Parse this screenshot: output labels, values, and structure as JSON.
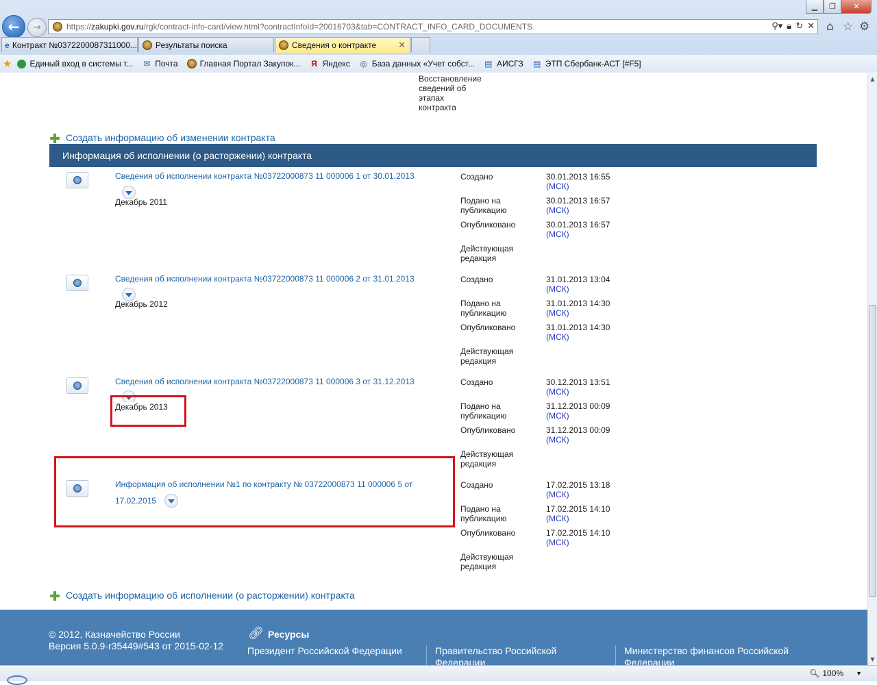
{
  "browser": {
    "url_prefix": "https://",
    "url_host": "zakupki.gov.ru",
    "url_rest": "/rgk/contract-info-card/view.html?contractInfoId=20016703&tab=CONTRACT_INFO_CARD_DOCUMENTS",
    "tabs": [
      {
        "label": "Контракт №0372200087311000..."
      },
      {
        "label": "Результаты поиска"
      },
      {
        "label": "Сведения о контракте"
      }
    ],
    "favorites": [
      {
        "label": "Единый вход в системы т..."
      },
      {
        "label": "Почта"
      },
      {
        "label": "Главная Портал Закупок..."
      },
      {
        "label": "Яндекс"
      },
      {
        "label": "База данных «Учет собст..."
      },
      {
        "label": "АИСГЗ"
      },
      {
        "label": "ЭТП Сбербанк-АСТ [#F5]"
      }
    ],
    "zoom": "100%"
  },
  "page": {
    "top_fragment": [
      "Восстановление",
      "сведений об",
      "этапах",
      "контракта"
    ],
    "create_change_link": "Создать информацию об изменении контракта",
    "section_title": "Информация об исполнении (о расторжении) контракта",
    "msk_label": "(МСК)",
    "status_labels": {
      "created": "Создано",
      "submitted_1": "Подано на",
      "submitted_2": "публикацию",
      "published": "Опубликовано",
      "current_1": "Действующая",
      "current_2": "редакция"
    },
    "records": [
      {
        "title": "Сведения об исполнении контракта №03722000873 11 000006 1 от 30.01.2013",
        "period": "Декабрь 2011",
        "created": "30.01.2013 16:55",
        "submitted": "30.01.2013 16:57",
        "published": "30.01.2013 16:57"
      },
      {
        "title": "Сведения об исполнении контракта №03722000873 11 000006 2 от 31.01.2013",
        "period": "Декабрь 2012",
        "created": "31.01.2013 13:04",
        "submitted": "31.01.2013 14:30",
        "published": "31.01.2013 14:30"
      },
      {
        "title": "Сведения об исполнении контракта №03722000873 11 000006 3 от 31.12.2013",
        "period": "Декабрь 2013",
        "created": "30.12.2013 13:51",
        "submitted": "31.12.2013 00:09",
        "published": "31.12.2013 00:09"
      },
      {
        "title_line1": "Информация об исполнении №1 по контракту № 03722000873 11 000006 5 от",
        "title_line2": "17.02.2015",
        "created": "17.02.2015 13:18",
        "submitted": "17.02.2015 14:10",
        "published": "17.02.2015 14:10"
      }
    ],
    "create_execution_link": "Создать информацию об исполнении (о расторжении) контракта"
  },
  "footer": {
    "copyright": "© 2012, Казначейство России",
    "version": "Версия 5.0.9-r35449#543 от 2015-02-12",
    "resources_title": "Ресурсы",
    "links": [
      {
        "line1": "Президент Российской Федерации",
        "line2": ""
      },
      {
        "line1": "Правительство Российской",
        "line2": "Федерации"
      },
      {
        "line1": "Министерство финансов Российской",
        "line2": "Федерации"
      }
    ]
  }
}
